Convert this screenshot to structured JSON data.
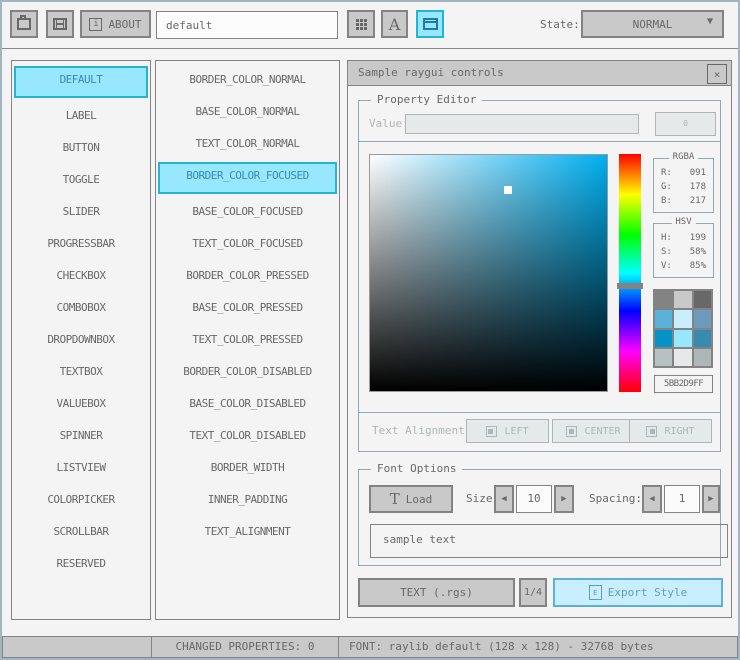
{
  "toolbar": {
    "about_button": "ABOUT",
    "style_name": "default",
    "state_label": "State:",
    "state_value": "NORMAL"
  },
  "icons": {
    "dropdown_arrow": "▼",
    "spin_left": "◀",
    "spin_right": "▶",
    "close": "×",
    "info": "i",
    "font_letter": "A",
    "load_letter": "T",
    "export_letter": "E"
  },
  "controls_list": [
    "DEFAULT",
    "LABEL",
    "BUTTON",
    "TOGGLE",
    "SLIDER",
    "PROGRESSBAR",
    "CHECKBOX",
    "COMBOBOX",
    "DROPDOWNBOX",
    "TEXTBOX",
    "VALUEBOX",
    "SPINNER",
    "LISTVIEW",
    "COLORPICKER",
    "SCROLLBAR",
    "RESERVED"
  ],
  "properties_list": [
    "BORDER_COLOR_NORMAL",
    "BASE_COLOR_NORMAL",
    "TEXT_COLOR_NORMAL",
    "BORDER_COLOR_FOCUSED",
    "BASE_COLOR_FOCUSED",
    "TEXT_COLOR_FOCUSED",
    "BORDER_COLOR_PRESSED",
    "BASE_COLOR_PRESSED",
    "TEXT_COLOR_PRESSED",
    "BORDER_COLOR_DISABLED",
    "BASE_COLOR_DISABLED",
    "TEXT_COLOR_DISABLED",
    "BORDER_WIDTH",
    "INNER_PADDING",
    "TEXT_ALIGNMENT"
  ],
  "selected_control": "DEFAULT",
  "selected_property": "BORDER_COLOR_FOCUSED",
  "window": {
    "title": "Sample raygui controls",
    "property_editor": {
      "title": "Property Editor",
      "value_label": "Value:",
      "value_input": "",
      "value_button": "0",
      "picker": {
        "hue_color": "#00aeef",
        "marker_s": "58%",
        "marker_v": "85%"
      },
      "rgba": {
        "title": "RGBA",
        "rows": [
          {
            "label": "R:",
            "value": "091"
          },
          {
            "label": "G:",
            "value": "178"
          },
          {
            "label": "B:",
            "value": "217"
          }
        ]
      },
      "hsv": {
        "title": "HSV",
        "rows": [
          {
            "label": "H:",
            "value": "199"
          },
          {
            "label": "S:",
            "value": "58%"
          },
          {
            "label": "V:",
            "value": "85%"
          }
        ]
      },
      "swatches": [
        "#838383",
        "#c9c9c9",
        "#686868",
        "#5bb2d9",
        "#c9effe",
        "#6c9bbc",
        "#0492c7",
        "#97e8ff",
        "#368baf",
        "#b5c1c2",
        "#e6e9e9",
        "#aeb7b7"
      ],
      "hex_value": "5BB2D9FF",
      "text_alignment_label": "Text Alignment:",
      "align_buttons": [
        "LEFT",
        "CENTER",
        "RIGHT"
      ]
    },
    "font_options": {
      "title": "Font Options",
      "load_button": "Load",
      "size_label": "Size:",
      "size_value": "10",
      "spacing_label": "Spacing:",
      "spacing_value": "1",
      "sample_text": "sample text"
    },
    "export_row": {
      "text_rgs_button": "TEXT (.rgs)",
      "page_indicator": "1/4",
      "export_button": "Export Style"
    }
  },
  "statusbar": {
    "changed_properties": "CHANGED PROPERTIES: 0",
    "font_info": "FONT: raylib default (128 x 128) - 32768 bytes"
  },
  "colors": {
    "accent_selected_bg": "#97e8ff",
    "accent_selected_border": "#0492c7",
    "focused_bg": "#c9effe",
    "focused_border": "#5bb2d9",
    "panel_bg": "#f4f4f4",
    "control_bg": "#c9c9c9",
    "control_border": "#838383",
    "text": "#686868",
    "disabled": "#aeb7b7",
    "line": "#90abb5"
  }
}
